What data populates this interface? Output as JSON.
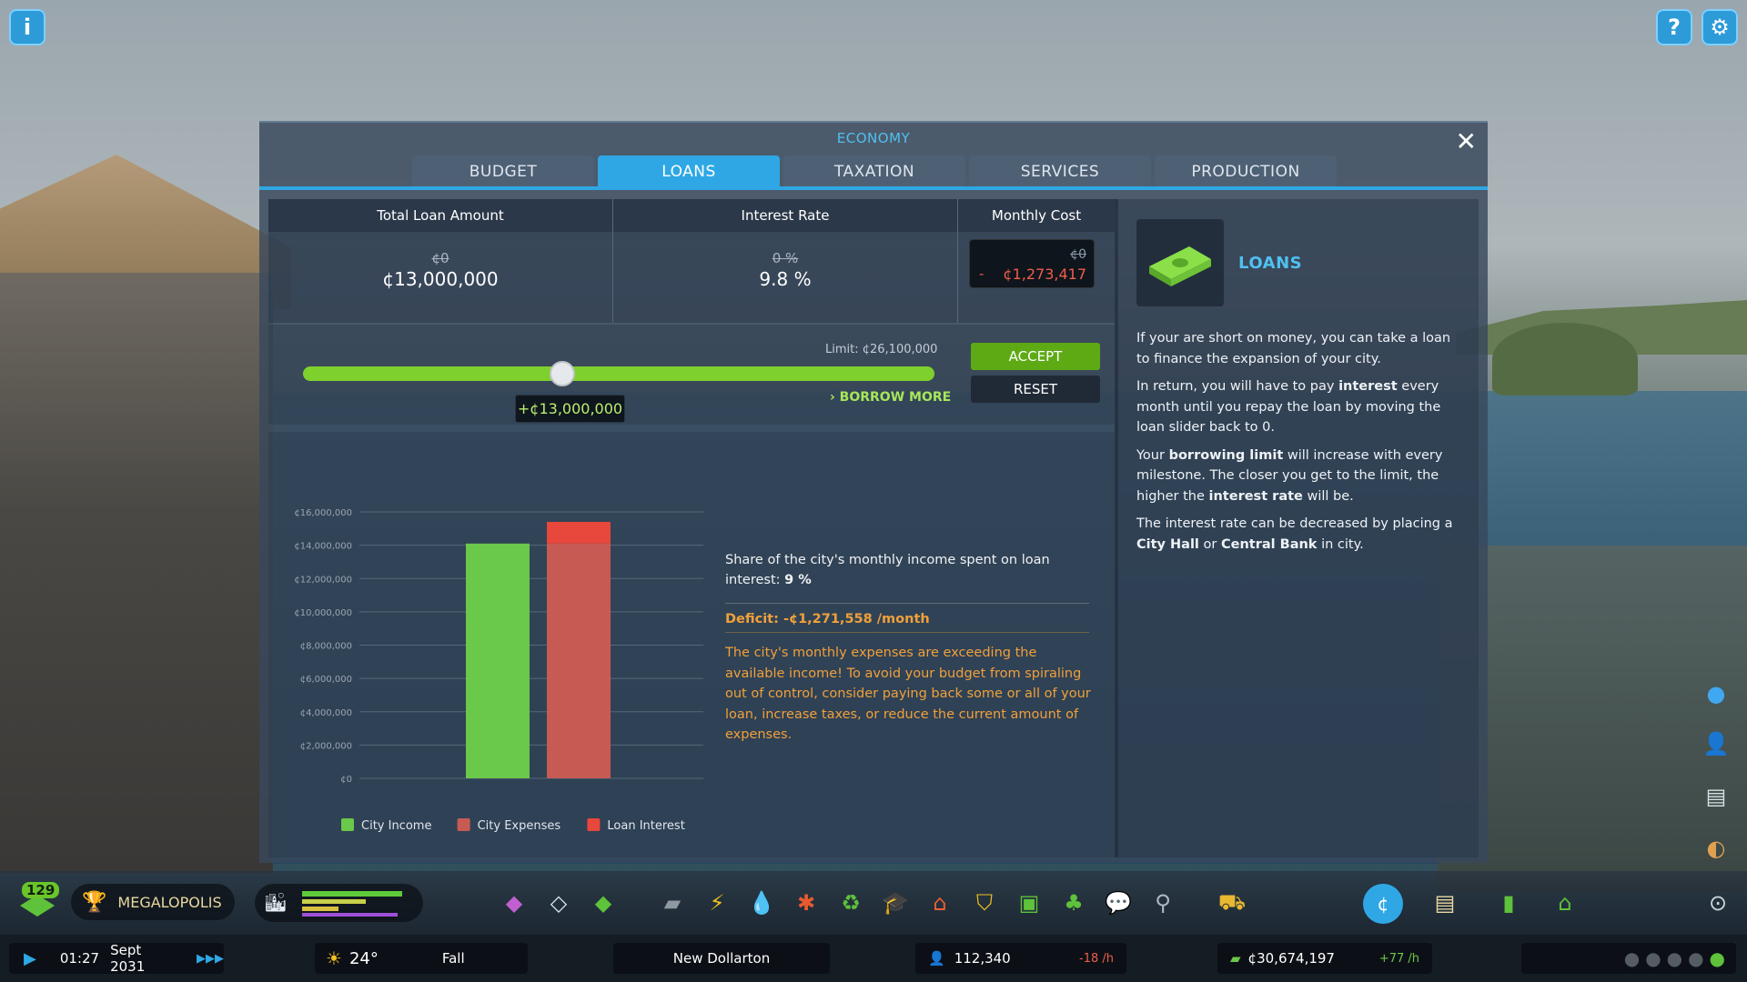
{
  "top": {
    "info_icon": "info-icon",
    "help_icon": "help-icon",
    "settings_icon": "gear-icon"
  },
  "panel": {
    "title": "ECONOMY",
    "tabs": [
      {
        "label": "BUDGET"
      },
      {
        "label": "LOANS",
        "active": true
      },
      {
        "label": "TAXATION"
      },
      {
        "label": "SERVICES"
      },
      {
        "label": "PRODUCTION"
      }
    ],
    "stats": {
      "total_loan": {
        "header": "Total Loan Amount",
        "old": "¢0",
        "value": "¢13,000,000"
      },
      "interest": {
        "header": "Interest Rate",
        "old": "0 %",
        "value": "9.8 %"
      },
      "monthly": {
        "header": "Monthly Cost",
        "old": "¢0",
        "sign": "-",
        "value": "¢1,273,417"
      }
    },
    "slider": {
      "limit": "Limit: ¢26,100,000",
      "tooltip": "+¢13,000,000",
      "fraction": 0.5,
      "borrow_more": "BORROW MORE",
      "accept": "ACCEPT",
      "reset": "RESET"
    },
    "info": {
      "share_text": "Share of the city's monthly income spent on loan interest:",
      "share_value": "9 %",
      "deficit": "Deficit: -¢1,271,558 /month",
      "warning": "The city's monthly expenses are exceeding the available income! To avoid your budget from spiraling out of control, consider paying back some or all of your loan, increase taxes, or reduce the current amount of expenses."
    },
    "right": {
      "title": "LOANS",
      "p1": "If your are short on money, you can take a loan to finance the expansion of your city.",
      "p2a": "In return, you will have to pay ",
      "p2b": "interest",
      "p2c": " every month until you repay the loan by moving the loan slider back to 0.",
      "p3a": "Your ",
      "p3b": "borrowing limit",
      "p3c": " will increase with every milestone. The closer you get to the limit, the higher the ",
      "p3d": "interest rate",
      "p3e": " will be.",
      "p4a": "The interest rate can be decreased by placing a ",
      "p4b": "City Hall",
      "p4c": " or ",
      "p4d": "Central Bank",
      "p4e": " in city."
    }
  },
  "chart_data": {
    "type": "bar",
    "yticks": [
      "¢16,000,000",
      "¢14,000,000",
      "¢12,000,000",
      "¢10,000,000",
      "¢8,000,000",
      "¢6,000,000",
      "¢4,000,000",
      "¢2,000,000",
      "¢0"
    ],
    "ylim": [
      0,
      16000000
    ],
    "bars": [
      {
        "name": "City Income",
        "segments": [
          {
            "series": "City Income",
            "value": 14100000
          }
        ]
      },
      {
        "name": "City Expenses",
        "segments": [
          {
            "series": "City Expenses",
            "value": 14100000
          },
          {
            "series": "Loan Interest",
            "value": 1300000
          }
        ]
      }
    ],
    "legend": [
      {
        "name": "City Income",
        "color": "#6ac84a"
      },
      {
        "name": "City Expenses",
        "color": "#c85a54"
      },
      {
        "name": "Loan Interest",
        "color": "#e8473b"
      }
    ]
  },
  "bottom": {
    "milestone_count": "129",
    "milestone_name": "MEGALOPOLIS",
    "time": "01:27",
    "date": "Sept 2031",
    "temperature": "24°",
    "season": "Fall",
    "city_name": "New Dollarton",
    "population": "112,340",
    "population_rate": "-18 /h",
    "money": "¢30,674,197",
    "money_rate": "+77 /h"
  }
}
